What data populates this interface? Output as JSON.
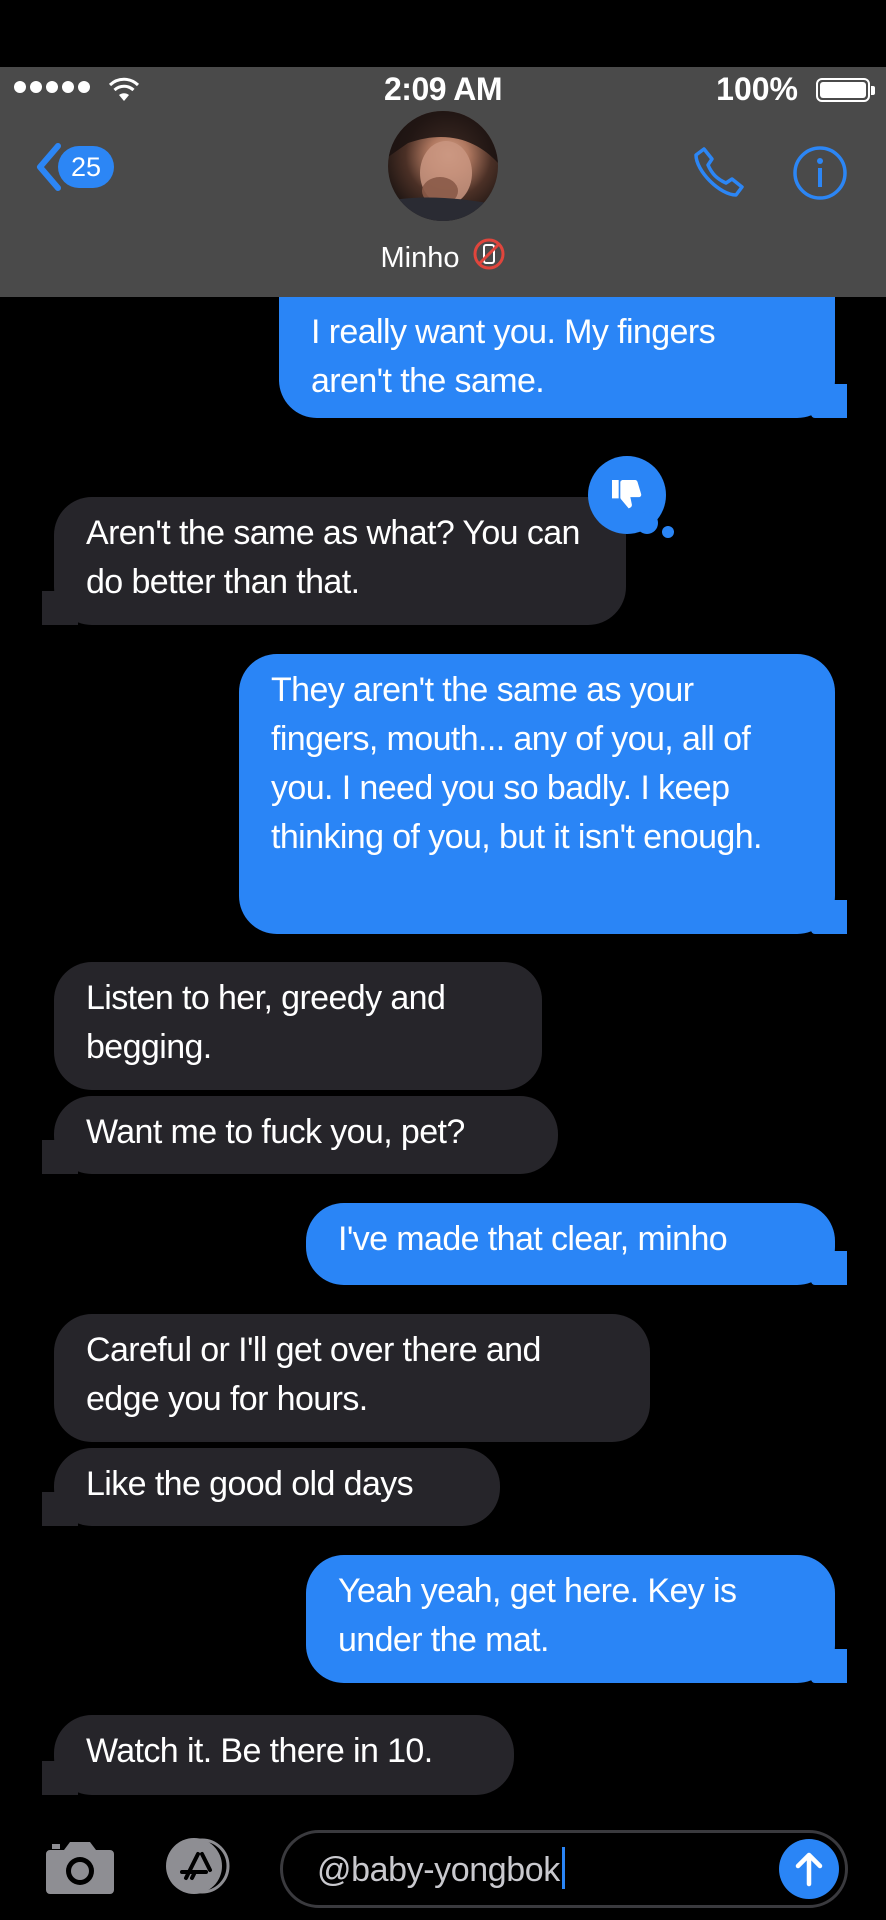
{
  "status_bar": {
    "time": "2:09 AM",
    "battery": "100%"
  },
  "nav": {
    "back_count": "25",
    "contact_name": "Minho"
  },
  "colors": {
    "sent_bubble": "#2a85f6",
    "received_bubble": "#26252a",
    "header": "#4a4a4a",
    "accent": "#2a85f6"
  },
  "messages": [
    {
      "from": "me",
      "text": "I really want you. My fingers aren't the same."
    },
    {
      "from": "them",
      "text": "Aren't the same as what? You can do better than that.",
      "tapback": "thumbs-down"
    },
    {
      "from": "me",
      "text": "They aren't the same as your fingers, mouth... any of you, all of you. I need you so badly. I keep thinking of you, but it isn't enough."
    },
    {
      "from": "them",
      "text": "Listen to her, greedy and begging."
    },
    {
      "from": "them",
      "text": "Want me to fuck you, pet?"
    },
    {
      "from": "me",
      "text": "I've made that clear, minho"
    },
    {
      "from": "them",
      "text": "Careful or I'll get over there and edge you for hours."
    },
    {
      "from": "them",
      "text": "Like the good old days"
    },
    {
      "from": "me",
      "text": "Yeah yeah, get here. Key is under the mat."
    },
    {
      "from": "them",
      "text": "Watch it. Be there in 10."
    }
  ],
  "composer": {
    "value": "@baby-yongbok"
  }
}
